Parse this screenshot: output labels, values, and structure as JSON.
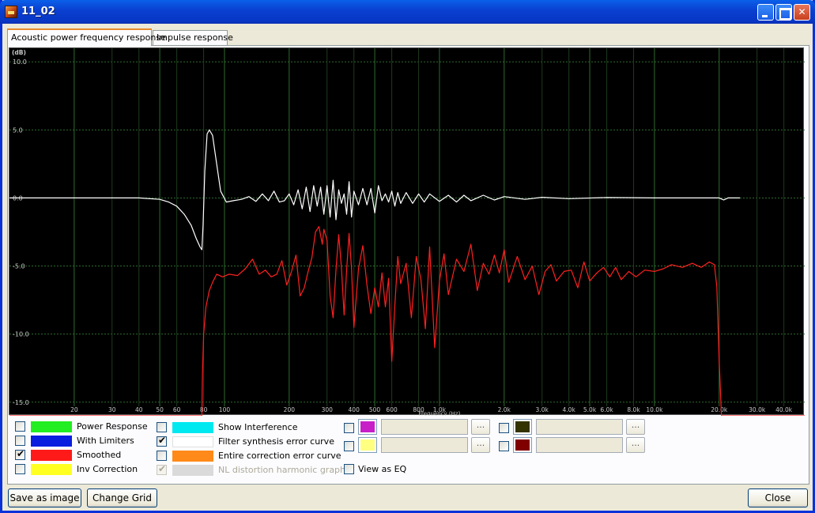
{
  "window": {
    "title": "11_02"
  },
  "tabs": [
    {
      "label": "Acoustic power frequency response",
      "active": true
    },
    {
      "label": "Impulse response",
      "active": false
    }
  ],
  "chart_data": {
    "type": "line",
    "ylabel": "(dB)",
    "xlabel": "Frequency (Hz)",
    "x_scale": "log",
    "xlim": [
      10,
      50000
    ],
    "ylim": [
      -16,
      11
    ],
    "y_ticks": [
      "10.0",
      "5.0",
      "0.0",
      "-5.0",
      "-10.0",
      "-15.0"
    ],
    "y_tick_values": [
      10,
      5,
      0,
      -5,
      -10,
      -15
    ],
    "x_ticks": [
      "20",
      "30",
      "40",
      "50",
      "60",
      "80",
      "100",
      "200",
      "300",
      "400",
      "500",
      "600",
      "800",
      "1.0k",
      "2.0k",
      "3.0k",
      "4.0k",
      "5.0k",
      "6.0k",
      "8.0k",
      "10.0k",
      "20.0k",
      "30.0k",
      "40.0k"
    ],
    "x_tick_values": [
      20,
      30,
      40,
      50,
      60,
      80,
      100,
      200,
      300,
      400,
      500,
      600,
      800,
      1000,
      2000,
      3000,
      4000,
      5000,
      6000,
      8000,
      10000,
      20000,
      30000,
      40000
    ],
    "grid": true,
    "series": [
      {
        "name": "Filter synthesis error curve",
        "color": "#ffffff",
        "points": [
          [
            10,
            0
          ],
          [
            30,
            0
          ],
          [
            40,
            0
          ],
          [
            50,
            -0.1
          ],
          [
            55,
            -0.3
          ],
          [
            60,
            -0.6
          ],
          [
            65,
            -1.2
          ],
          [
            70,
            -2
          ],
          [
            74,
            -3
          ],
          [
            77,
            -3.6
          ],
          [
            78.5,
            -3.8
          ],
          [
            79.5,
            -2
          ],
          [
            81,
            2
          ],
          [
            83,
            4.7
          ],
          [
            85,
            5
          ],
          [
            88,
            4.6
          ],
          [
            92,
            2.5
          ],
          [
            96,
            0.5
          ],
          [
            102,
            -0.3
          ],
          [
            110,
            -0.2
          ],
          [
            120,
            -0.1
          ],
          [
            130,
            0.1
          ],
          [
            140,
            -0.25
          ],
          [
            150,
            0.3
          ],
          [
            160,
            -0.2
          ],
          [
            170,
            0.5
          ],
          [
            180,
            -0.3
          ],
          [
            190,
            -0.2
          ],
          [
            200,
            0.3
          ],
          [
            210,
            -0.5
          ],
          [
            220,
            0.6
          ],
          [
            230,
            -0.8
          ],
          [
            240,
            0.8
          ],
          [
            250,
            -1
          ],
          [
            260,
            0.9
          ],
          [
            270,
            -0.6
          ],
          [
            280,
            0.8
          ],
          [
            290,
            -1.2
          ],
          [
            300,
            0.9
          ],
          [
            310,
            -1.4
          ],
          [
            320,
            1.3
          ],
          [
            330,
            -1.6
          ],
          [
            340,
            0.6
          ],
          [
            350,
            -0.4
          ],
          [
            360,
            0.3
          ],
          [
            370,
            -1.2
          ],
          [
            380,
            1.2
          ],
          [
            390,
            -1.4
          ],
          [
            400,
            0.5
          ],
          [
            420,
            -0.5
          ],
          [
            440,
            0.7
          ],
          [
            460,
            -0.5
          ],
          [
            480,
            0.7
          ],
          [
            500,
            -1.1
          ],
          [
            520,
            0.9
          ],
          [
            540,
            -0.2
          ],
          [
            560,
            0.3
          ],
          [
            580,
            -0.3
          ],
          [
            600,
            0.5
          ],
          [
            620,
            -0.6
          ],
          [
            640,
            0.4
          ],
          [
            660,
            -0.4
          ],
          [
            700,
            0.4
          ],
          [
            750,
            -0.4
          ],
          [
            800,
            0.3
          ],
          [
            850,
            -0.3
          ],
          [
            900,
            0.3
          ],
          [
            1000,
            -0.25
          ],
          [
            1100,
            0.2
          ],
          [
            1200,
            -0.3
          ],
          [
            1300,
            0.2
          ],
          [
            1400,
            -0.2
          ],
          [
            1600,
            0.2
          ],
          [
            1800,
            -0.15
          ],
          [
            2000,
            0.1
          ],
          [
            2500,
            -0.1
          ],
          [
            3000,
            0.05
          ],
          [
            4000,
            -0.05
          ],
          [
            6000,
            0.03
          ],
          [
            10000,
            0
          ],
          [
            20000,
            0
          ],
          [
            21000,
            -0.15
          ],
          [
            22000,
            0
          ],
          [
            25000,
            0
          ]
        ]
      },
      {
        "name": "Smoothed",
        "color": "#ff2020",
        "points": [
          [
            10,
            -16
          ],
          [
            78.5,
            -16
          ],
          [
            79,
            -13
          ],
          [
            80,
            -10
          ],
          [
            82,
            -8
          ],
          [
            85,
            -6.8
          ],
          [
            88,
            -6.2
          ],
          [
            92,
            -5.6
          ],
          [
            98,
            -5.8
          ],
          [
            105,
            -5.6
          ],
          [
            115,
            -5.7
          ],
          [
            125,
            -5.2
          ],
          [
            135,
            -4.5
          ],
          [
            145,
            -5.6
          ],
          [
            155,
            -5.3
          ],
          [
            165,
            -5.8
          ],
          [
            175,
            -5.6
          ],
          [
            185,
            -4.6
          ],
          [
            195,
            -6.4
          ],
          [
            205,
            -5.4
          ],
          [
            215,
            -4.2
          ],
          [
            225,
            -7.2
          ],
          [
            235,
            -6.6
          ],
          [
            245,
            -5.4
          ],
          [
            255,
            -4.4
          ],
          [
            265,
            -2.5
          ],
          [
            275,
            -2.1
          ],
          [
            285,
            -3.4
          ],
          [
            290,
            -2.3
          ],
          [
            300,
            -3.1
          ],
          [
            310,
            -7.2
          ],
          [
            320,
            -8.8
          ],
          [
            330,
            -5.3
          ],
          [
            340,
            -2.7
          ],
          [
            350,
            -5.1
          ],
          [
            360,
            -8.6
          ],
          [
            370,
            -5.3
          ],
          [
            380,
            -2.6
          ],
          [
            390,
            -5.2
          ],
          [
            400,
            -9.5
          ],
          [
            420,
            -5.2
          ],
          [
            440,
            -3.5
          ],
          [
            460,
            -6.4
          ],
          [
            480,
            -8.5
          ],
          [
            500,
            -6.6
          ],
          [
            520,
            -8
          ],
          [
            540,
            -5.5
          ],
          [
            560,
            -8
          ],
          [
            580,
            -5.9
          ],
          [
            600,
            -12
          ],
          [
            620,
            -7.9
          ],
          [
            640,
            -4.3
          ],
          [
            660,
            -6.3
          ],
          [
            700,
            -4.8
          ],
          [
            740,
            -8.8
          ],
          [
            780,
            -4.3
          ],
          [
            820,
            -6
          ],
          [
            860,
            -9.6
          ],
          [
            900,
            -3.6
          ],
          [
            950,
            -11
          ],
          [
            1000,
            -6.1
          ],
          [
            1050,
            -4.1
          ],
          [
            1100,
            -7.1
          ],
          [
            1200,
            -4.5
          ],
          [
            1300,
            -5.4
          ],
          [
            1400,
            -3.4
          ],
          [
            1500,
            -6.8
          ],
          [
            1600,
            -4.8
          ],
          [
            1700,
            -5.6
          ],
          [
            1800,
            -4.2
          ],
          [
            1900,
            -5.5
          ],
          [
            2000,
            -3.8
          ],
          [
            2100,
            -6.2
          ],
          [
            2300,
            -4.3
          ],
          [
            2500,
            -6
          ],
          [
            2700,
            -5
          ],
          [
            2900,
            -7.1
          ],
          [
            3100,
            -5.4
          ],
          [
            3300,
            -4.9
          ],
          [
            3500,
            -6.1
          ],
          [
            3800,
            -5.4
          ],
          [
            4100,
            -5.3
          ],
          [
            4400,
            -6.6
          ],
          [
            4700,
            -4.7
          ],
          [
            5000,
            -6.1
          ],
          [
            5400,
            -5.5
          ],
          [
            5800,
            -5.1
          ],
          [
            6200,
            -5.8
          ],
          [
            6600,
            -5.1
          ],
          [
            7000,
            -6
          ],
          [
            7600,
            -5.4
          ],
          [
            8200,
            -5.8
          ],
          [
            9000,
            -5.3
          ],
          [
            10000,
            -5.4
          ],
          [
            11000,
            -5.2
          ],
          [
            12000,
            -4.9
          ],
          [
            13500,
            -5.1
          ],
          [
            15000,
            -4.8
          ],
          [
            16500,
            -5.1
          ],
          [
            18000,
            -4.7
          ],
          [
            19000,
            -4.9
          ],
          [
            19500,
            -6.5
          ],
          [
            20000,
            -12
          ],
          [
            20500,
            -16
          ],
          [
            50000,
            -16
          ]
        ]
      }
    ]
  },
  "legend": [
    {
      "label": "Power Response",
      "color": "#22ee22",
      "checked": false,
      "enabled": true
    },
    {
      "label": "With Limiters",
      "color": "#0a1ee0",
      "checked": false,
      "enabled": true
    },
    {
      "label": "Smoothed",
      "color": "#ff1a1a",
      "checked": true,
      "enabled": true
    },
    {
      "label": "Inv Correction",
      "color": "#ffff22",
      "checked": false,
      "enabled": true
    },
    {
      "label": "Show Interference",
      "color": "#00e8f0",
      "checked": false,
      "enabled": true
    },
    {
      "label": "Filter synthesis error curve",
      "color": "#ffffff",
      "checked": true,
      "enabled": true
    },
    {
      "label": "Entire correction error curve",
      "color": "#ff8a1a",
      "checked": false,
      "enabled": true
    },
    {
      "label": "NL distortion harmonic graphs",
      "color": "#dadada",
      "checked": true,
      "enabled": false
    }
  ],
  "custom_curves": [
    {
      "color": "#c81ec8",
      "text": ""
    },
    {
      "color": "#ffff80",
      "text": ""
    },
    {
      "color": "#333300",
      "text": ""
    },
    {
      "color": "#800000",
      "text": ""
    }
  ],
  "dots_label": "...",
  "view_as_eq": {
    "label": "View as EQ",
    "checked": false
  },
  "buttons": {
    "save": "Save as image",
    "grid": "Change Grid",
    "close": "Close"
  },
  "colors": {
    "grid_major": "#2e6b2e",
    "grid_minor": "#2a2a2a",
    "axis_text": "#c8c8c8"
  }
}
